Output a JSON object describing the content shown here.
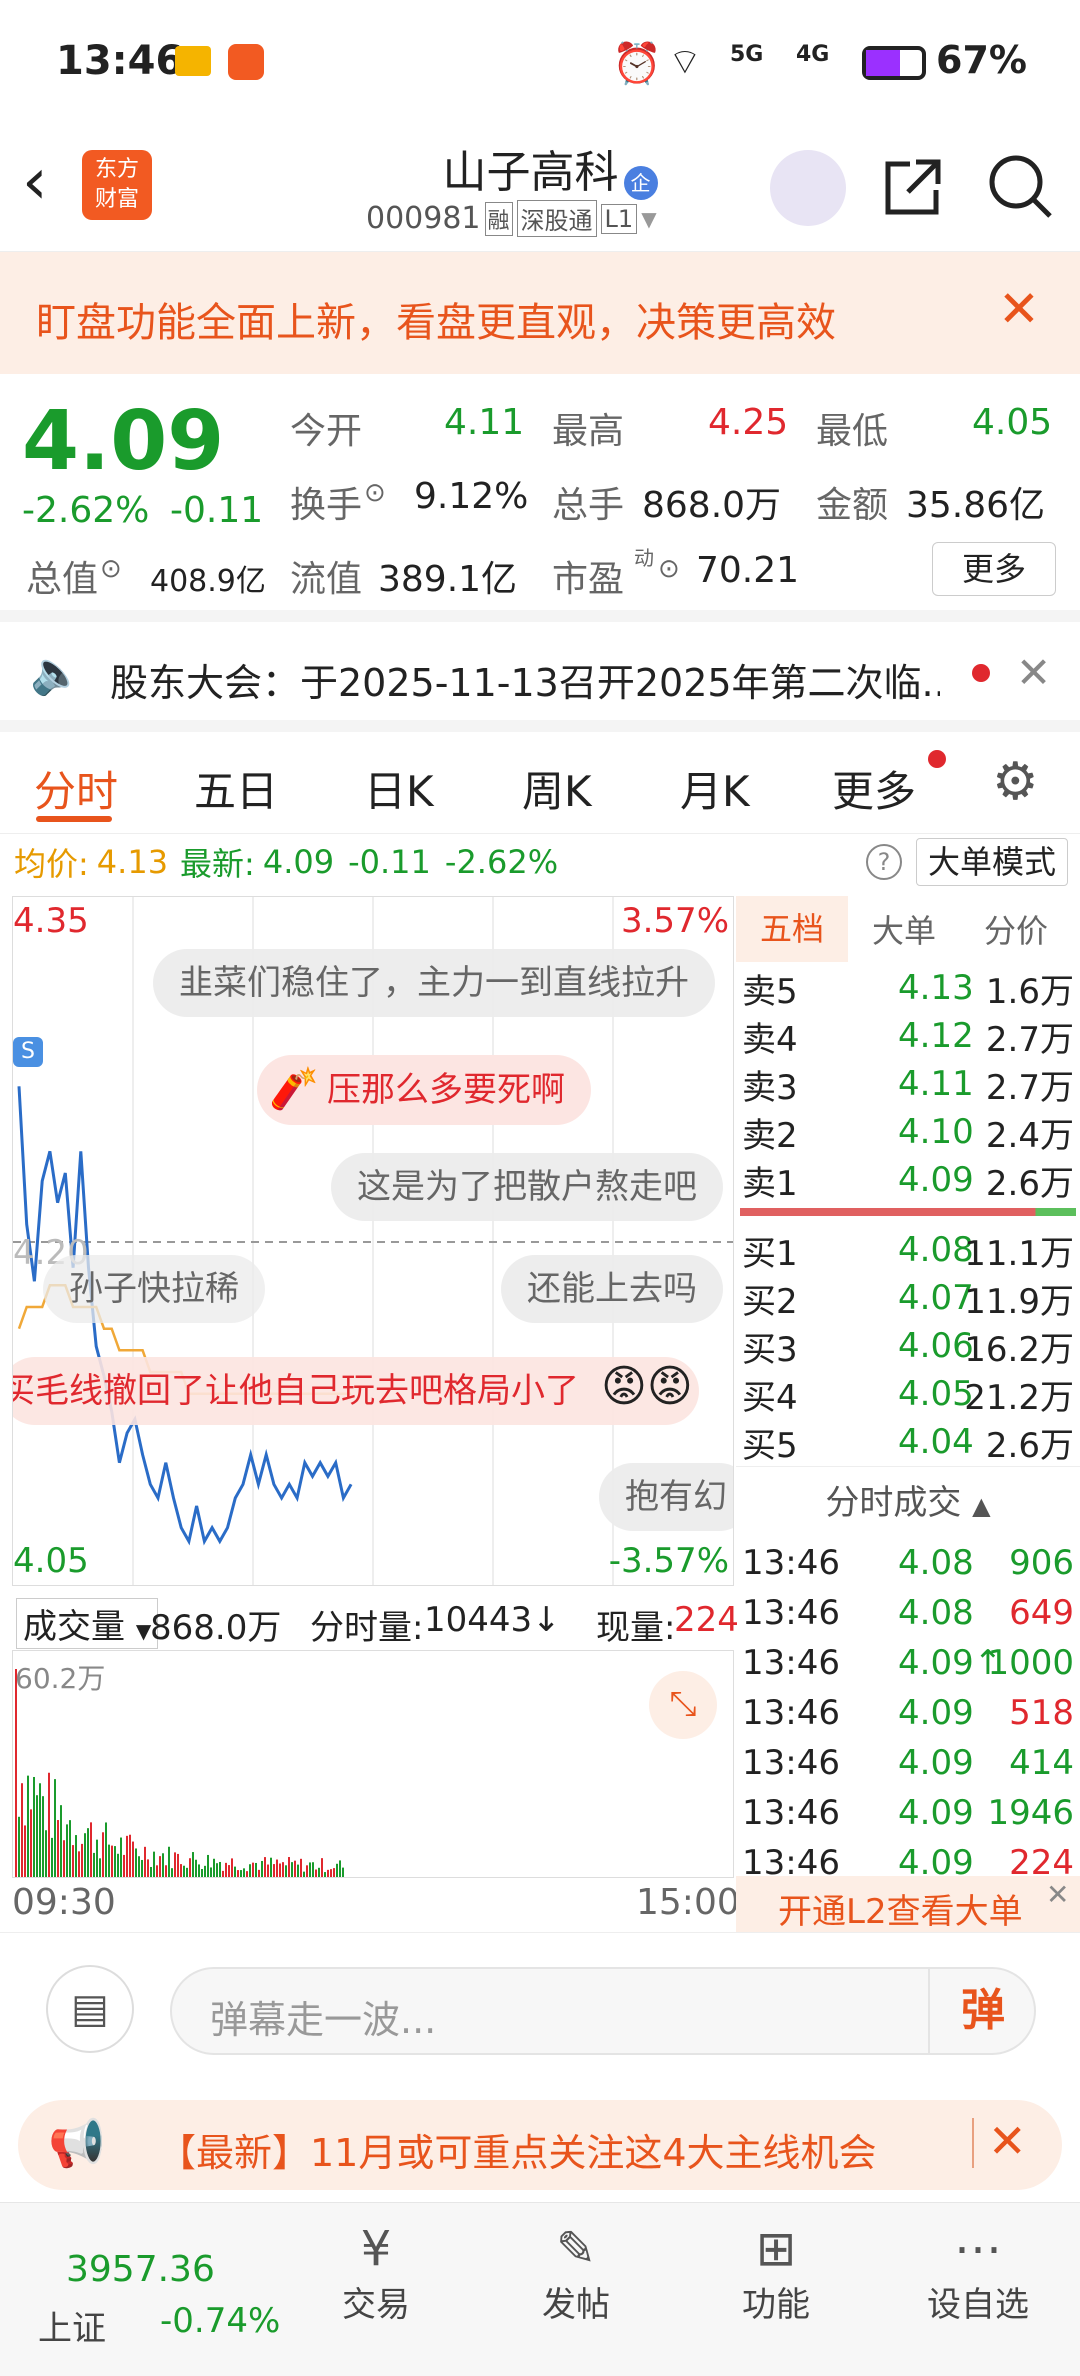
{
  "status": {
    "time": "13:46",
    "battery": "67%",
    "net1": "5G",
    "net2": "4G"
  },
  "header": {
    "title": "山子高科",
    "code": "000981",
    "tag1": "融",
    "tag2": "深股通",
    "tag3": "L1",
    "logo_line1": "东方",
    "logo_line2": "财富",
    "badge": "企"
  },
  "banner": {
    "text": "盯盘功能全面上新，看盘更直观，决策更高效"
  },
  "quote": {
    "price": "4.09",
    "pct": "-2.62%",
    "chg": "-0.11",
    "open_label": "今开",
    "open": "4.11",
    "high_label": "最高",
    "high": "4.25",
    "low_label": "最低",
    "low": "4.05",
    "turnover_label": "换手",
    "turnover": "9.12%",
    "vol_label": "总手",
    "vol": "868.0万",
    "amt_label": "金额",
    "amt": "35.86亿",
    "mcap_label": "总值",
    "mcap": "408.9亿",
    "float_label": "流值",
    "float": "389.1亿",
    "pe_label": "市盈",
    "pe_sup": "动",
    "pe": "70.21",
    "more": "更多"
  },
  "notice": {
    "text": "股东大会：于2025-11-13召开2025年第二次临..."
  },
  "tabs": [
    "分时",
    "五日",
    "日K",
    "周K",
    "月K",
    "更多"
  ],
  "avgline": {
    "avg_label": "均价:",
    "avg": "4.13",
    "last_label": "最新:",
    "last": "4.09",
    "chg": "-0.11",
    "pct": "-2.62%",
    "mode": "大单模式"
  },
  "chart_data": {
    "type": "line",
    "x_start": "09:30",
    "x_end": "15:00",
    "y_max": "4.35",
    "y_min": "4.05",
    "pct_max": "3.57%",
    "pct_min": "-3.57%",
    "ref": "4.20",
    "series": [
      {
        "values": [
          4.27,
          4.21,
          4.18,
          4.23,
          4.24,
          4.22,
          4.23,
          4.19,
          4.24,
          4.19,
          4.15,
          4.14,
          4.12,
          4.1,
          4.11,
          4.12,
          4.1,
          4.09,
          4.08,
          4.1,
          4.08,
          4.07,
          4.06,
          4.08,
          4.06,
          4.07,
          4.06,
          4.07,
          4.08,
          4.09,
          4.1,
          4.09,
          4.1,
          4.09,
          4.08,
          4.09,
          4.08,
          4.1,
          4.09,
          4.1,
          4.09,
          4.1,
          4.08,
          4.09
        ]
      },
      {
        "values": [
          4.16,
          4.17,
          4.17,
          4.17,
          4.18,
          4.18,
          4.18,
          4.17,
          4.17,
          4.17,
          4.17,
          4.16,
          4.16,
          4.15,
          4.15,
          4.15,
          4.15,
          4.14,
          4.14,
          4.14,
          4.14,
          4.14,
          4.13,
          4.13,
          4.13,
          4.13,
          4.13,
          4.13,
          4.13,
          4.13,
          4.13,
          4.13,
          4.13,
          4.13,
          4.13,
          4.13,
          4.13,
          4.13,
          4.13,
          4.13,
          4.13,
          4.13,
          4.13,
          4.13
        ]
      }
    ]
  },
  "danmu": [
    {
      "text": "韭菜们稳住了，主力一到直线拉升"
    },
    {
      "text": "压那么多要死啊"
    },
    {
      "text": "这是为了把散户熬走吧"
    },
    {
      "text": "孙子快拉稀"
    },
    {
      "text": "还能上去吗"
    },
    {
      "text": "买毛线撤回了让他自己玩去吧格局小了"
    },
    {
      "text": "抱有幻"
    }
  ],
  "vol_bar": {
    "label": "成交量",
    "total": "868.0万",
    "min_label": "分时量:",
    "min": "10443↓",
    "now_label": "现量:",
    "now": "224",
    "top": "60.2万"
  },
  "orderbook": {
    "tabs": [
      "五档",
      "大单",
      "分价"
    ],
    "sell": [
      {
        "l": "卖5",
        "p": "4.13",
        "v": "1.6万"
      },
      {
        "l": "卖4",
        "p": "4.12",
        "v": "2.7万"
      },
      {
        "l": "卖3",
        "p": "4.11",
        "v": "2.7万"
      },
      {
        "l": "卖2",
        "p": "4.10",
        "v": "2.4万"
      },
      {
        "l": "卖1",
        "p": "4.09",
        "v": "2.6万"
      }
    ],
    "buy": [
      {
        "l": "买1",
        "p": "4.08",
        "v": "11.1万"
      },
      {
        "l": "买2",
        "p": "4.07",
        "v": "11.9万"
      },
      {
        "l": "买3",
        "p": "4.06",
        "v": "16.2万"
      },
      {
        "l": "买4",
        "p": "4.05",
        "v": "21.2万"
      },
      {
        "l": "买5",
        "p": "4.04",
        "v": "2.6万"
      }
    ]
  },
  "ticks": {
    "title": "分时成交",
    "rows": [
      {
        "t": "13:46",
        "p": "4.08",
        "v": "906"
      },
      {
        "t": "13:46",
        "p": "4.08",
        "v": "649"
      },
      {
        "t": "13:46",
        "p": "4.09↑",
        "v": "1000"
      },
      {
        "t": "13:46",
        "p": "4.09",
        "v": "518"
      },
      {
        "t": "13:46",
        "p": "4.09",
        "v": "414"
      },
      {
        "t": "13:46",
        "p": "4.09",
        "v": "1946"
      },
      {
        "t": "13:46",
        "p": "4.09",
        "v": "224"
      }
    ],
    "l2": "开通L2查看大单"
  },
  "input": {
    "placeholder": "弹幕走一波...",
    "send": "弹"
  },
  "ad": {
    "text": "【最新】11月或可重点关注这4大主线机会"
  },
  "bottom": {
    "index_value": "3957.36",
    "index_name": "上证",
    "index_pct": "-0.74%",
    "items": [
      "交易",
      "发帖",
      "功能",
      "设自选"
    ]
  }
}
